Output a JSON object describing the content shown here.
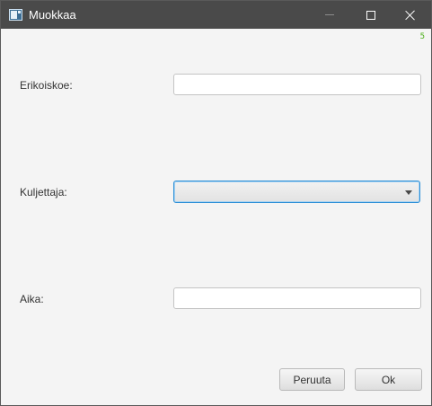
{
  "window": {
    "title": "Muokkaa",
    "corner_badge": "5"
  },
  "form": {
    "fields": [
      {
        "label": "Erikoiskoe:",
        "value": ""
      },
      {
        "label": "Kuljettaja:",
        "value": ""
      },
      {
        "label": "Aika:",
        "value": ""
      }
    ]
  },
  "buttons": {
    "cancel": "Peruuta",
    "ok": "Ok"
  },
  "colors": {
    "titlebar": "#4a4a4a",
    "background": "#f4f4f4",
    "focus_border": "#2b8ed6",
    "badge": "#4caf1a"
  },
  "icons": [
    "app-icon",
    "minimize-icon",
    "maximize-icon",
    "close-icon",
    "dropdown-arrow-icon"
  ]
}
